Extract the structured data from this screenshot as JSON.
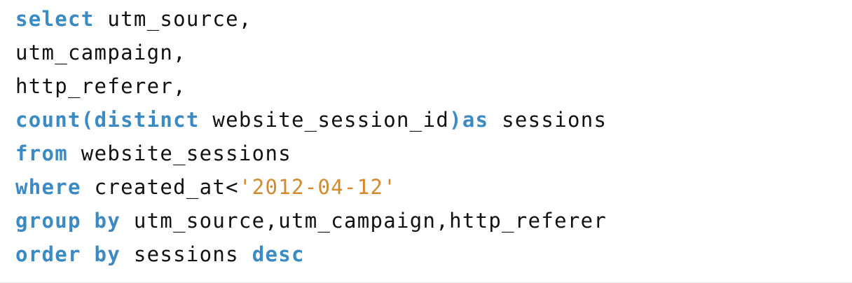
{
  "code": {
    "lines": [
      {
        "tokens": [
          {
            "text": "select",
            "kind": "keyword"
          },
          {
            "text": " utm_source,",
            "kind": "plain"
          }
        ]
      },
      {
        "tokens": [
          {
            "text": "utm_campaign,",
            "kind": "plain"
          }
        ]
      },
      {
        "tokens": [
          {
            "text": "http_referer,",
            "kind": "plain"
          }
        ]
      },
      {
        "tokens": [
          {
            "text": "count",
            "kind": "keyword"
          },
          {
            "text": "(",
            "kind": "keyword"
          },
          {
            "text": "distinct",
            "kind": "keyword"
          },
          {
            "text": " website_session_id",
            "kind": "plain"
          },
          {
            "text": ")",
            "kind": "keyword"
          },
          {
            "text": "as",
            "kind": "keyword"
          },
          {
            "text": " sessions",
            "kind": "plain"
          }
        ]
      },
      {
        "tokens": [
          {
            "text": "from",
            "kind": "keyword"
          },
          {
            "text": " website_sessions",
            "kind": "plain"
          }
        ]
      },
      {
        "tokens": [
          {
            "text": "where",
            "kind": "keyword"
          },
          {
            "text": " created_at<",
            "kind": "plain"
          },
          {
            "text": "'2012-04-12'",
            "kind": "string"
          }
        ]
      },
      {
        "tokens": [
          {
            "text": "group by",
            "kind": "keyword"
          },
          {
            "text": " utm_source,utm_campaign,http_referer",
            "kind": "plain"
          }
        ]
      },
      {
        "tokens": [
          {
            "text": "order by",
            "kind": "keyword"
          },
          {
            "text": " sessions ",
            "kind": "plain"
          },
          {
            "text": "desc",
            "kind": "keyword"
          }
        ]
      }
    ]
  },
  "colors": {
    "keyword": "#3a8bc4",
    "string": "#d4892c",
    "plain": "#111111",
    "background": "#ffffff"
  }
}
